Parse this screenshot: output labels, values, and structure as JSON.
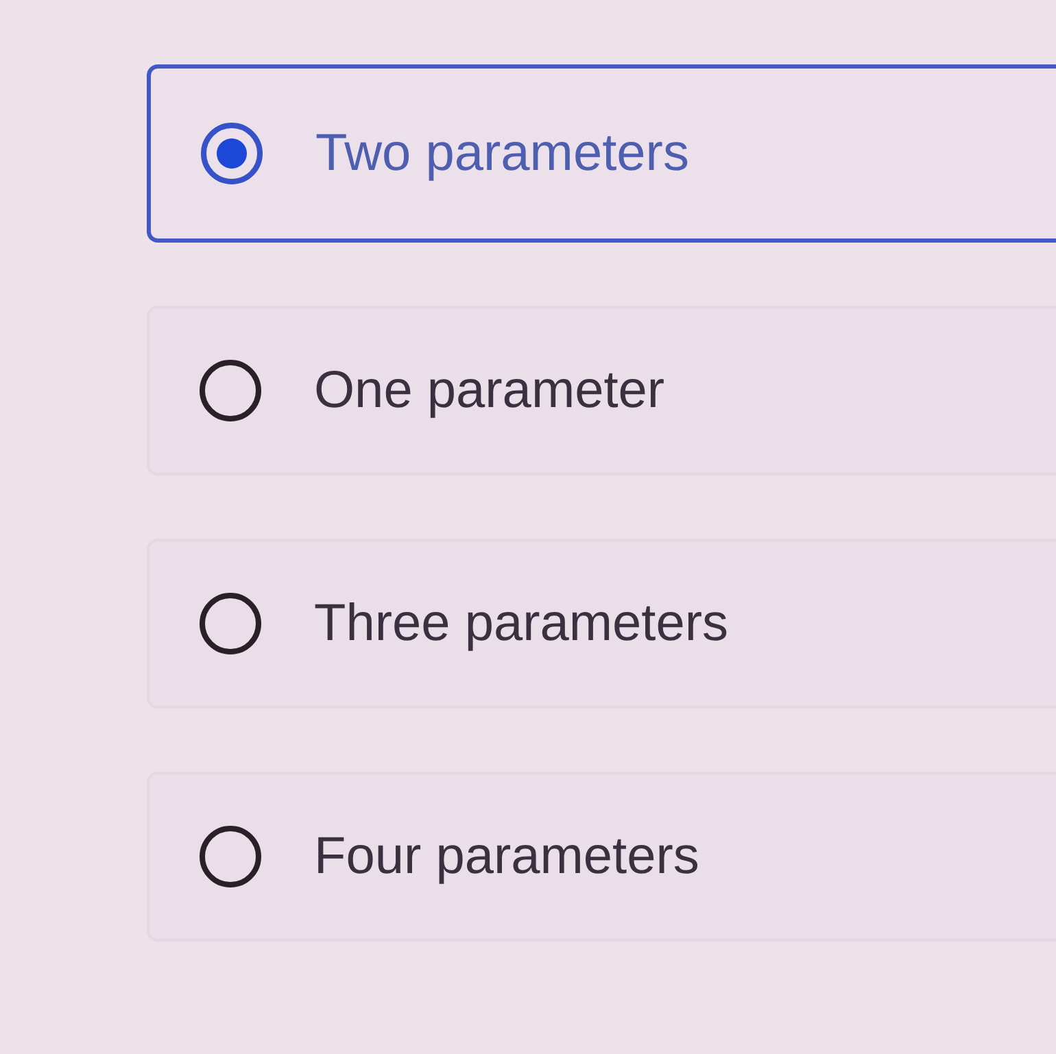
{
  "options": [
    {
      "label": "Two parameters",
      "selected": true
    },
    {
      "label": "One parameter",
      "selected": false
    },
    {
      "label": "Three parameters",
      "selected": false
    },
    {
      "label": "Four parameters",
      "selected": false
    }
  ]
}
